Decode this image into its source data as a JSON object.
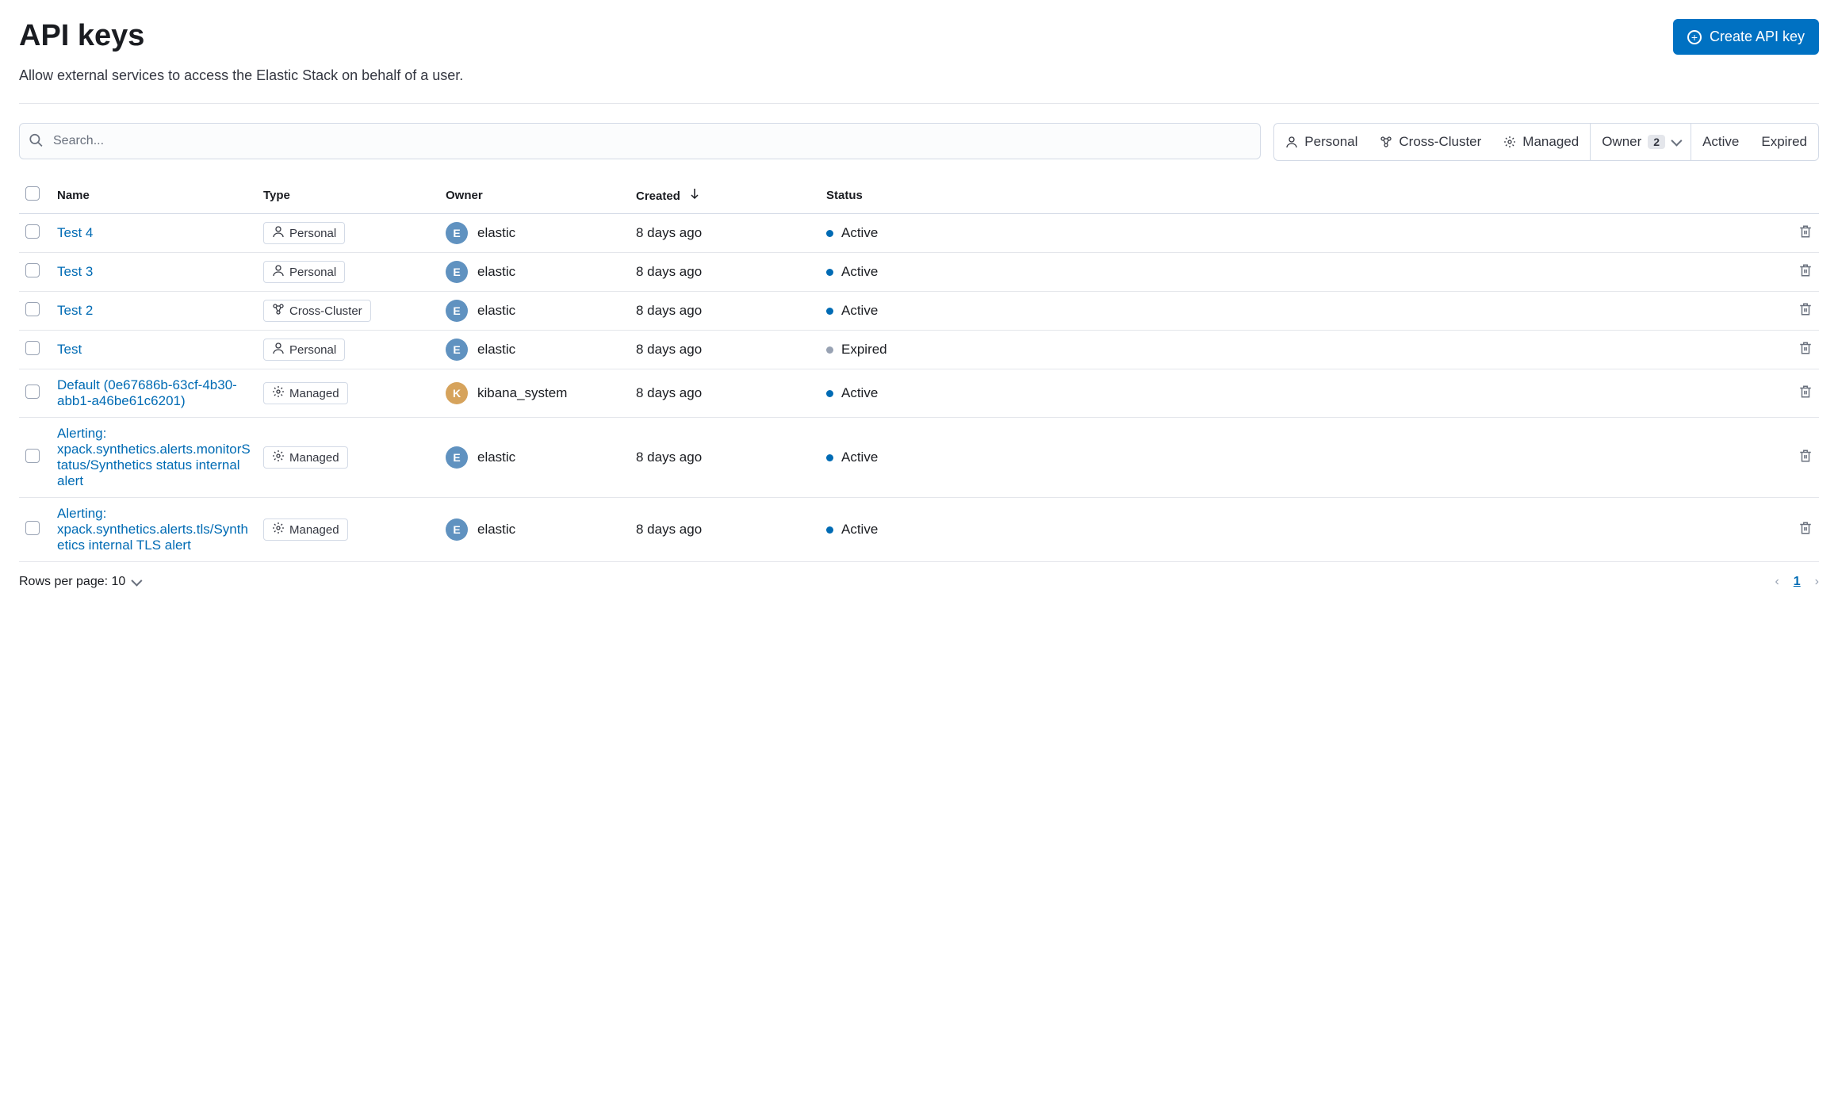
{
  "header": {
    "title": "API keys",
    "subtitle": "Allow external services to access the Elastic Stack on behalf of a user.",
    "create_label": "Create API key"
  },
  "search": {
    "placeholder": "Search..."
  },
  "filters": {
    "personal": "Personal",
    "cross_cluster": "Cross-Cluster",
    "managed": "Managed",
    "owner_label": "Owner",
    "owner_count": "2",
    "active": "Active",
    "expired": "Expired"
  },
  "table": {
    "headers": {
      "name": "Name",
      "type": "Type",
      "owner": "Owner",
      "created": "Created",
      "status": "Status"
    },
    "rows": [
      {
        "name": "Test 4",
        "type": "Personal",
        "type_icon": "user",
        "owner": "elastic",
        "avatar": "E",
        "avatar_color": "blue",
        "created": "8 days ago",
        "status": "Active",
        "status_kind": "active"
      },
      {
        "name": "Test 3",
        "type": "Personal",
        "type_icon": "user",
        "owner": "elastic",
        "avatar": "E",
        "avatar_color": "blue",
        "created": "8 days ago",
        "status": "Active",
        "status_kind": "active"
      },
      {
        "name": "Test 2",
        "type": "Cross-Cluster",
        "type_icon": "cluster",
        "owner": "elastic",
        "avatar": "E",
        "avatar_color": "blue",
        "created": "8 days ago",
        "status": "Active",
        "status_kind": "active"
      },
      {
        "name": "Test",
        "type": "Personal",
        "type_icon": "user",
        "owner": "elastic",
        "avatar": "E",
        "avatar_color": "blue",
        "created": "8 days ago",
        "status": "Expired",
        "status_kind": "expired"
      },
      {
        "name": "Default (0e67686b-63cf-4b30-abb1-a46be61c6201)",
        "type": "Managed",
        "type_icon": "gear",
        "owner": "kibana_system",
        "avatar": "K",
        "avatar_color": "orange",
        "created": "8 days ago",
        "status": "Active",
        "status_kind": "active"
      },
      {
        "name": "Alerting: xpack.synthetics.alerts.monitorStatus/Synthetics status internal alert",
        "type": "Managed",
        "type_icon": "gear",
        "owner": "elastic",
        "avatar": "E",
        "avatar_color": "blue",
        "created": "8 days ago",
        "status": "Active",
        "status_kind": "active"
      },
      {
        "name": "Alerting: xpack.synthetics.alerts.tls/Synthetics internal TLS alert",
        "type": "Managed",
        "type_icon": "gear",
        "owner": "elastic",
        "avatar": "E",
        "avatar_color": "blue",
        "created": "8 days ago",
        "status": "Active",
        "status_kind": "active"
      }
    ]
  },
  "footer": {
    "rows_per_page_label": "Rows per page: 10",
    "current_page": "1"
  }
}
